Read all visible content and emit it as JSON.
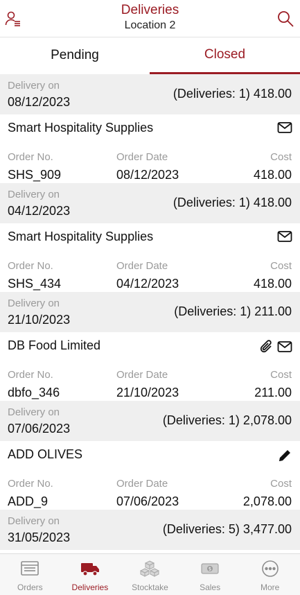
{
  "header": {
    "title": "Deliveries",
    "subtitle": "Location 2",
    "left_icon": "user-list-icon",
    "right_icon": "search-icon"
  },
  "tabs": [
    {
      "label": "Pending"
    },
    {
      "label": "Closed"
    }
  ],
  "colors": {
    "brand": "#9b1c24",
    "muted": "#9a9a9a",
    "band": "#efefef"
  },
  "groups": [
    {
      "label": "Delivery on",
      "date": "08/12/2023",
      "summary": "(Deliveries: 1) 418.00",
      "items": [
        {
          "supplier": "Smart Hospitality Supplies",
          "order_no_label": "Order No.",
          "order_no": "SHS_909",
          "order_date_label": "Order Date",
          "order_date": "08/12/2023",
          "cost_label": "Cost",
          "cost": "418.00",
          "icons": [
            "envelope-icon"
          ]
        }
      ]
    },
    {
      "label": "Delivery on",
      "date": "04/12/2023",
      "summary": "(Deliveries: 1) 418.00",
      "items": [
        {
          "supplier": "Smart Hospitality Supplies",
          "order_no_label": "Order No.",
          "order_no": "SHS_434",
          "order_date_label": "Order Date",
          "order_date": "04/12/2023",
          "cost_label": "Cost",
          "cost": "418.00",
          "icons": [
            "envelope-icon"
          ]
        }
      ]
    },
    {
      "label": "Delivery on",
      "date": "21/10/2023",
      "summary": "(Deliveries: 1) 211.00",
      "items": [
        {
          "supplier": "DB Food Limited",
          "order_no_label": "Order No.",
          "order_no": "dbfo_346",
          "order_date_label": "Order Date",
          "order_date": "21/10/2023",
          "cost_label": "Cost",
          "cost": "211.00",
          "icons": [
            "paperclip-icon",
            "envelope-icon"
          ]
        }
      ]
    },
    {
      "label": "Delivery on",
      "date": "07/06/2023",
      "summary": "(Deliveries: 1) 2,078.00",
      "items": [
        {
          "supplier": "ADD OLIVES",
          "order_no_label": "Order No.",
          "order_no": "ADD_9",
          "order_date_label": "Order Date",
          "order_date": "07/06/2023",
          "cost_label": "Cost",
          "cost": "2,078.00",
          "icons": [
            "pencil-icon"
          ]
        }
      ]
    },
    {
      "label": "Delivery on",
      "date": "31/05/2023",
      "summary": "(Deliveries: 5) 3,477.00",
      "items": []
    }
  ],
  "tabbar": [
    {
      "label": "Orders",
      "icon": "orders-icon",
      "active": false
    },
    {
      "label": "Deliveries",
      "icon": "truck-icon",
      "active": true
    },
    {
      "label": "Stocktake",
      "icon": "boxes-icon",
      "active": false
    },
    {
      "label": "Sales",
      "icon": "cash-icon",
      "active": false
    },
    {
      "label": "More",
      "icon": "more-icon",
      "active": false
    }
  ]
}
